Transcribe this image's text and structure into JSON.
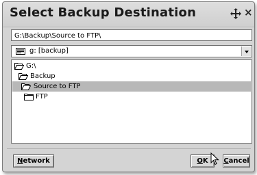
{
  "dialog": {
    "title": "Select Backup Destination",
    "close_glyph": "×",
    "path_value": "G:\\Backup\\Source to FTP\\",
    "drive": {
      "label": "g: [backup]",
      "icon": "drive-icon"
    },
    "tree": [
      {
        "label": "G:\\",
        "icon": "open-folder-icon",
        "selected": false
      },
      {
        "label": "Backup",
        "icon": "open-folder-icon",
        "selected": false
      },
      {
        "label": "Source to FTP",
        "icon": "open-folder-icon",
        "selected": true
      },
      {
        "label": "FTP",
        "icon": "folder-icon",
        "selected": false
      }
    ],
    "buttons": {
      "network": {
        "mnemonic": "N",
        "rest": "etwork"
      },
      "ok": {
        "mnemonic": "O",
        "rest": "K"
      },
      "cancel": {
        "mnemonic": "C",
        "rest": "ancel"
      }
    }
  },
  "colors": {
    "dialog_bg": "#d4d4d4",
    "selection_bg": "#b8b8b8"
  }
}
